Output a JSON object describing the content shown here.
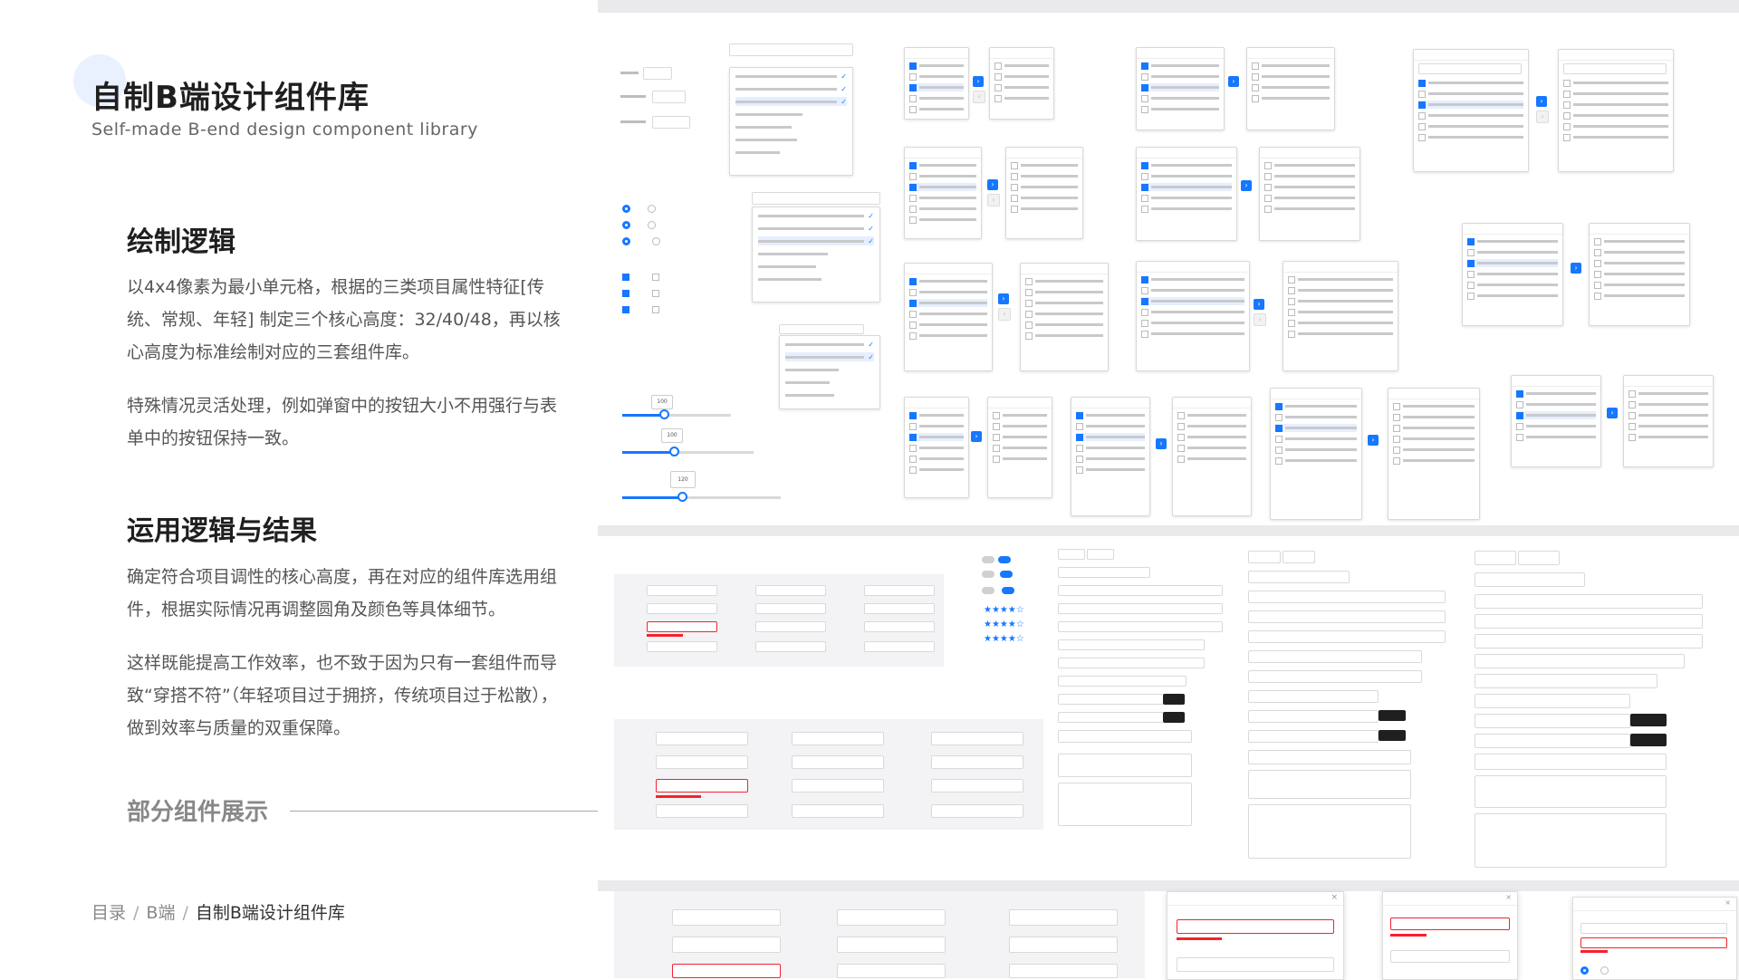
{
  "header": {
    "title": "自制B端设计组件库",
    "subtitle": "Self-made B-end design component library"
  },
  "sections": [
    {
      "heading": "绘制逻辑",
      "paragraphs": [
        "以4x4像素为最小单元格，根据的三类项目属性特征[传统、常规、年轻] 制定三个核心高度：32/40/48，再以核心高度为标准绘制对应的三套组件库。",
        "特殊情况灵活处理，例如弹窗中的按钮大小不用强行与表单中的按钮保持一致。"
      ]
    },
    {
      "heading": "运用逻辑与结果",
      "paragraphs": [
        "确定符合项目调性的核心高度，再在对应的组件库选用组件，根据实际情况再调整圆角及颜色等具体细节。",
        "这样既能提高工作效率，也不致于因为只有一套组件而导致“穿搭不符”（年轻项目过于拥挤，传统项目过于松散），做到效率与质量的双重保障。"
      ]
    }
  ],
  "showcase": {
    "label": "部分组件展示"
  },
  "breadcrumb": {
    "items": [
      "目录",
      "B端"
    ],
    "current": "自制B端设计组件库",
    "separator": "/"
  },
  "colors": {
    "accent": "#1677ff",
    "error": "#f5222d",
    "panel_bg": "#eaeaec"
  },
  "components": {
    "sliders": [
      "100",
      "100",
      "120"
    ]
  }
}
